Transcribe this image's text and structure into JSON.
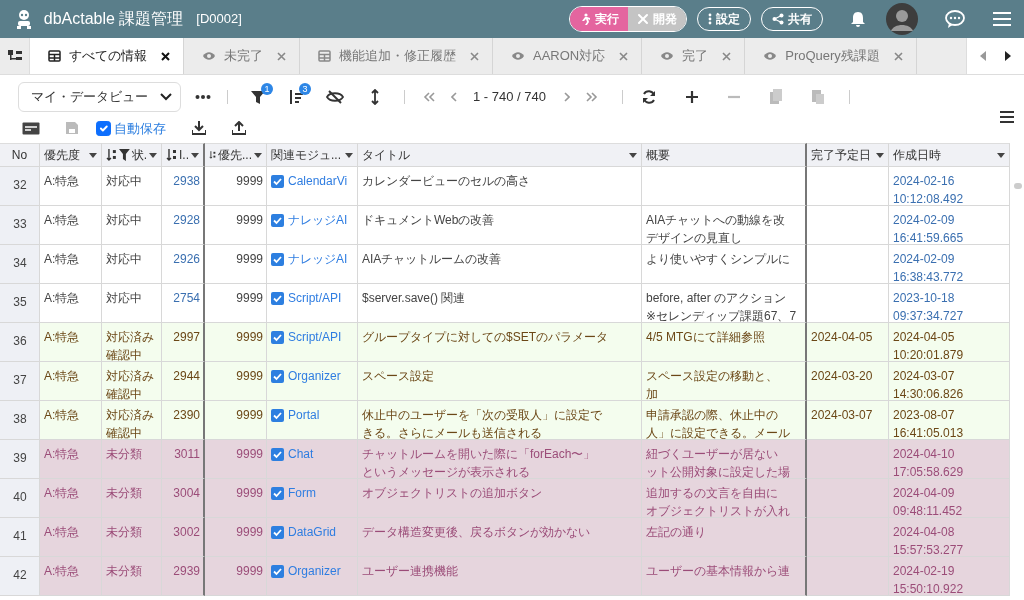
{
  "app": {
    "title": "dbActable 課題管理",
    "code": "[D0002]"
  },
  "mode_buttons": [
    {
      "label": "実行",
      "selected": true
    },
    {
      "label": "開発",
      "selected": false
    }
  ],
  "header_buttons": [
    "設定",
    "共有"
  ],
  "tabs": [
    {
      "kind": "table",
      "label": "すべての情報",
      "selected": true
    },
    {
      "kind": "eye",
      "label": "未完了",
      "selected": false
    },
    {
      "kind": "table",
      "label": "機能追加・修正履歴",
      "selected": false
    },
    {
      "kind": "eye",
      "label": "AARON対応",
      "selected": false
    },
    {
      "kind": "eye",
      "label": "完了",
      "selected": false
    },
    {
      "kind": "eye",
      "label": "ProQuery残課題",
      "selected": false
    }
  ],
  "toolbar": {
    "view_select": "マイ・データビュー",
    "filter_count": "1",
    "sort_count": "3",
    "pager": "1 - 740 / 740",
    "autosave": {
      "label": "自動保存",
      "checked": true
    }
  },
  "table": {
    "columns": [
      {
        "label": "No",
        "sort": false,
        "filter": false,
        "menu": false
      },
      {
        "label": "優先度",
        "sort": false,
        "filter": false,
        "menu": true
      },
      {
        "label": "状.",
        "sort": true,
        "filter": true,
        "menu": true
      },
      {
        "label": "I..",
        "sort": true,
        "filter": false,
        "menu": true
      },
      {
        "label": "優先...",
        "sort": true,
        "filter": false,
        "menu": true
      },
      {
        "label": "関連モジュ...",
        "sort": false,
        "filter": false,
        "menu": true
      },
      {
        "label": "タイトル",
        "sort": false,
        "filter": false,
        "menu": true
      },
      {
        "label": "概要",
        "sort": false,
        "filter": false,
        "menu": false
      },
      {
        "label": "完了予定日",
        "sort": false,
        "filter": false,
        "menu": true
      },
      {
        "label": "作成日時",
        "sort": false,
        "filter": false,
        "menu": true
      }
    ],
    "rows": [
      {
        "kind": "normal",
        "no": "32",
        "priority": "A:特急",
        "status": [
          "対応中"
        ],
        "id": "2938",
        "order": "9999",
        "module_checked": true,
        "module": "CalendarVi",
        "title": [
          "カレンダービューのセルの高さ"
        ],
        "summary": [],
        "created": [
          "2024-02-16",
          "10:12:08.492"
        ]
      },
      {
        "kind": "normal",
        "no": "33",
        "priority": "A:特急",
        "status": [
          "対応中"
        ],
        "id": "2928",
        "order": "9999",
        "module_checked": true,
        "module": "ナレッジAI",
        "title": [
          "ドキュメントWebの改善"
        ],
        "summary": [
          "AIAチャットへの動線を改",
          "デザインの見直し"
        ],
        "created": [
          "2024-02-09",
          "16:41:59.665"
        ]
      },
      {
        "kind": "normal",
        "no": "34",
        "priority": "A:特急",
        "status": [
          "対応中"
        ],
        "id": "2926",
        "order": "9999",
        "module_checked": true,
        "module": "ナレッジAI",
        "title": [
          "AIAチャットルームの改善"
        ],
        "summary": [
          "より使いやすくシンプルに"
        ],
        "created": [
          "2024-02-09",
          "16:38:43.772"
        ]
      },
      {
        "kind": "normal",
        "no": "35",
        "priority": "A:特急",
        "status": [
          "対応中"
        ],
        "id": "2754",
        "order": "9999",
        "module_checked": true,
        "module": "Script/API",
        "title": [
          "$server.save() 関連"
        ],
        "summary": [
          "before, after のアクション",
          "※セレンディップ課題67、7"
        ],
        "created": [
          "2023-10-18",
          "09:37:34.727"
        ]
      },
      {
        "kind": "review",
        "no": "36",
        "priority": "A:特急",
        "status": [
          "対応済み",
          "確認中"
        ],
        "id": "2997",
        "order": "9999",
        "module_checked": true,
        "module": "Script/API",
        "title": [
          "グループタイプに対しての$SETのパラメータ"
        ],
        "summary": [
          "4/5 MTGにて詳細参照"
        ],
        "due": "2024-04-05",
        "created": [
          "2024-04-05",
          "10:20:01.879"
        ]
      },
      {
        "kind": "review",
        "no": "37",
        "priority": "A:特急",
        "status": [
          "対応済み",
          "確認中"
        ],
        "id": "2944",
        "order": "9999",
        "module_checked": true,
        "module": "Organizer",
        "title": [
          "スペース設定"
        ],
        "summary": [
          "スペース設定の移動と、",
          "加"
        ],
        "due": "2024-03-20",
        "created": [
          "2024-03-07",
          "14:30:06.826"
        ]
      },
      {
        "kind": "review",
        "no": "38",
        "priority": "A:特急",
        "status": [
          "対応済み",
          "確認中"
        ],
        "id": "2390",
        "order": "9999",
        "module_checked": true,
        "module": "Portal",
        "title": [
          "休止中のユーザーを「次の受取人」に設定で",
          "きる。さらにメールも送信される"
        ],
        "summary": [
          "申請承認の際、休止中の",
          "人」に設定できる。メール"
        ],
        "due": "2024-03-07",
        "created": [
          "2023-08-07",
          "16:41:05.013"
        ]
      },
      {
        "kind": "unclassified",
        "no": "39",
        "priority": "A:特急",
        "status": [
          "未分類"
        ],
        "id": "3011",
        "order": "9999",
        "module_checked": true,
        "module": "Chat",
        "title": [
          "チャットルームを開いた際に「forEach〜」",
          "というメッセージが表示される"
        ],
        "summary": [
          "紐づくユーザーが居ない",
          "ット公開対象に設定した場"
        ],
        "created": [
          "2024-04-10",
          "17:05:58.629"
        ]
      },
      {
        "kind": "unclassified",
        "no": "40",
        "priority": "A:特急",
        "status": [
          "未分類"
        ],
        "id": "3004",
        "order": "9999",
        "module_checked": true,
        "module": "Form",
        "title": [
          "オブジェクトリストの追加ボタン"
        ],
        "summary": [
          "追加するの文言を自由に",
          "オブジェクトリストが入れ"
        ],
        "created": [
          "2024-04-09",
          "09:48:11.452"
        ]
      },
      {
        "kind": "unclassified",
        "no": "41",
        "priority": "A:特急",
        "status": [
          "未分類"
        ],
        "id": "3002",
        "order": "9999",
        "module_checked": true,
        "module": "DataGrid",
        "title": [
          "データ構造変更後、戻るボタンが効かない"
        ],
        "summary": [
          "左記の通り"
        ],
        "created": [
          "2024-04-08",
          "15:57:53.277"
        ]
      },
      {
        "kind": "unclassified",
        "no": "42",
        "priority": "A:特急",
        "status": [
          "未分類"
        ],
        "id": "2939",
        "order": "9999",
        "module_checked": true,
        "module": "Organizer",
        "title": [
          "ユーザー連携機能"
        ],
        "summary": [
          "ユーザーの基本情報から連"
        ],
        "created": [
          "2024-02-19",
          "15:50:10.922"
        ]
      }
    ]
  }
}
